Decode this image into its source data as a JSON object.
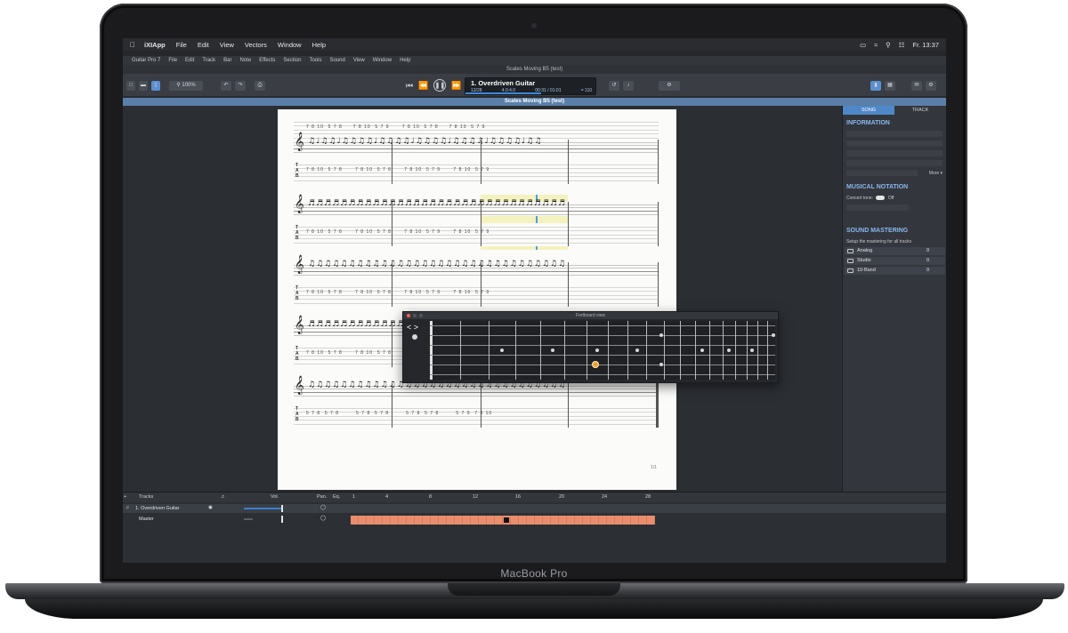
{
  "device": {
    "brand_label": "MacBook Pro"
  },
  "macos_menu": {
    "app": "iXIApp",
    "items": [
      "File",
      "Edit",
      "View",
      "Vectors",
      "Window",
      "Help"
    ],
    "clock": "Fr. 13:37"
  },
  "app_menu": {
    "items": [
      "Guitar Pro 7",
      "File",
      "Edit",
      "Track",
      "Bar",
      "Note",
      "Effects",
      "Section",
      "Tools",
      "Sound",
      "View",
      "Window",
      "Help"
    ]
  },
  "window_title": "Scales Moving B5 (test)",
  "document_title": "Scales Moving B5 (test)",
  "toolbar": {
    "zoom": "100%"
  },
  "lcd": {
    "track_name": "1. Overdriven Guitar",
    "bar_pos": "13/28",
    "signature": "4.0:4.0",
    "time": "00:31 / 01:01",
    "tempo": "= 110"
  },
  "tab_label": "T\nA\nB",
  "score": {
    "page_number": "1/1"
  },
  "fretboard": {
    "title": "Fretboard view",
    "nav_label": "< >"
  },
  "inspector": {
    "tabs": [
      "SONG",
      "TRACK"
    ],
    "information_header": "INFORMATION",
    "more_label": "More ▾",
    "notation_header": "MUSICAL NOTATION",
    "concert_tone_label": "Concert tone:",
    "concert_tone_value": "Off",
    "mastering_header": "SOUND MASTERING",
    "mastering_desc": "Setup the mastering for all tracks",
    "mastering_rows": [
      {
        "label": "Analog",
        "value": "0"
      },
      {
        "label": "Studio",
        "value": "0"
      },
      {
        "label": "10-Band",
        "value": "0"
      }
    ]
  },
  "tracks_panel": {
    "header": "Tracks",
    "vol_label": "Vol.",
    "pan_label": "Pan.",
    "eq_label": "Eq.",
    "bar_numbers": [
      "1",
      "4",
      "8",
      "12",
      "16",
      "20",
      "24",
      "28"
    ],
    "rows": [
      {
        "name": "1. Overdriven Guitar"
      },
      {
        "name": "Master"
      }
    ]
  }
}
